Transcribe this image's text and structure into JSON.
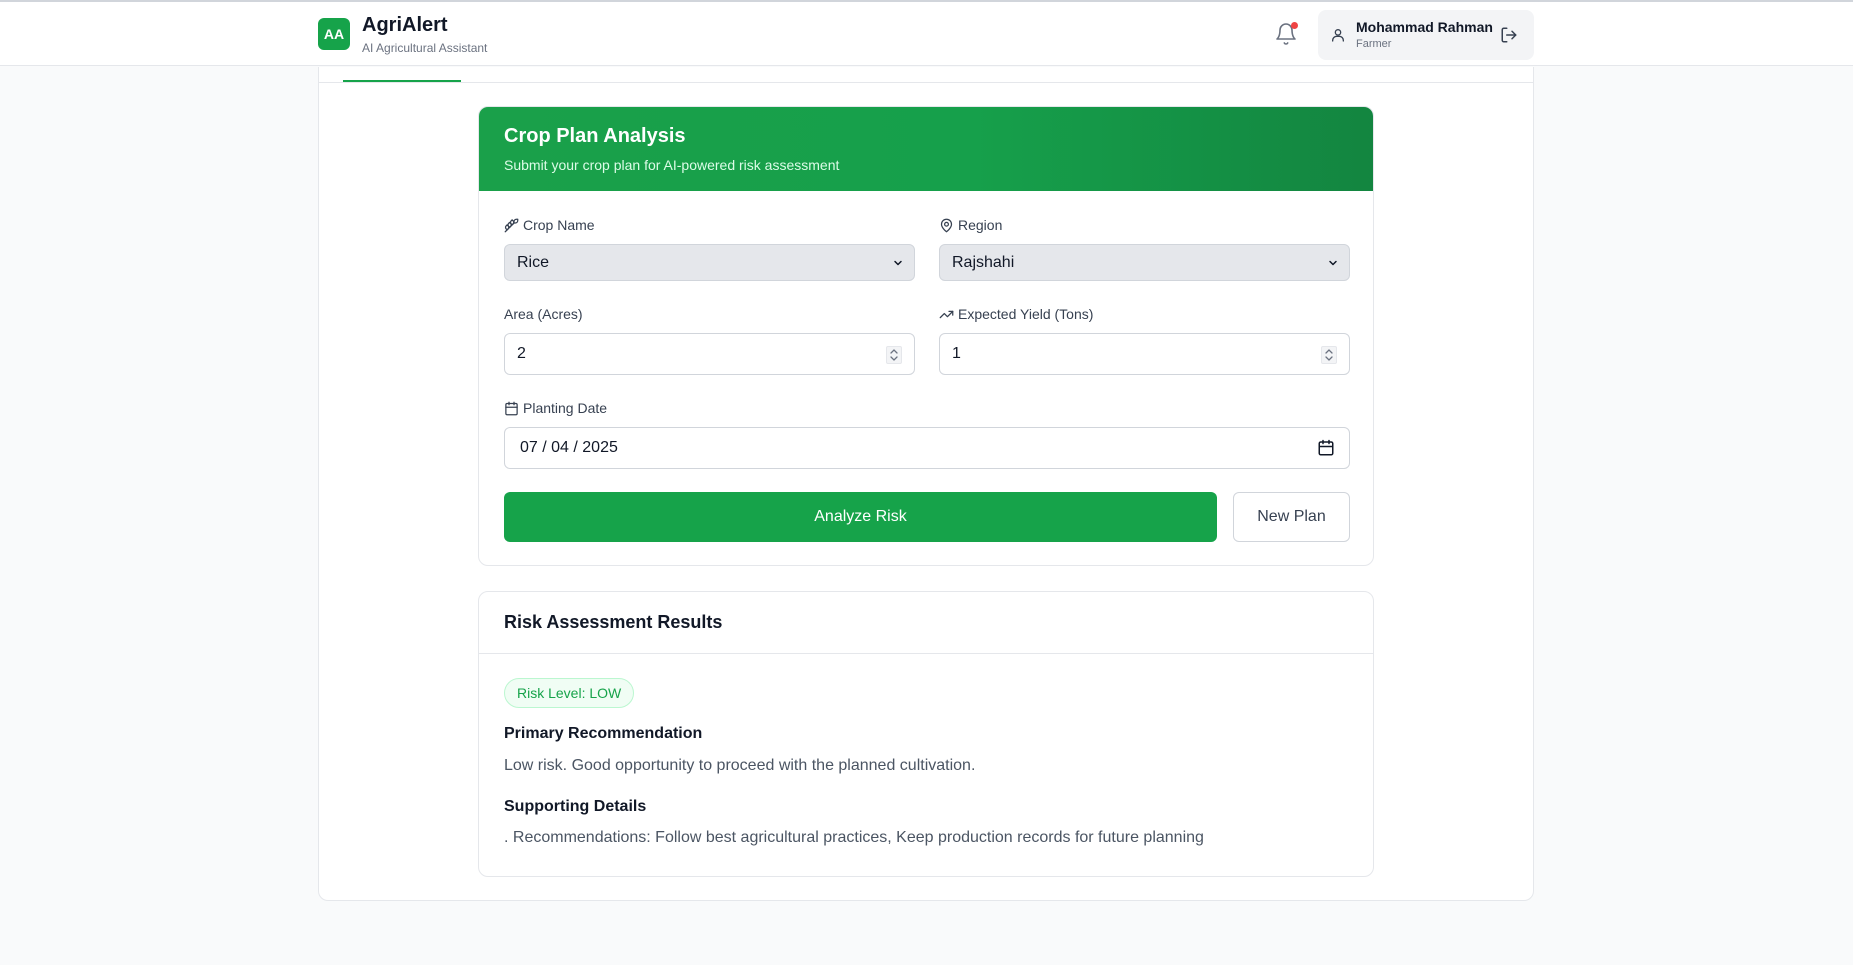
{
  "app": {
    "logo_text": "AA",
    "title": "AgriAlert",
    "subtitle": "AI Agricultural Assistant"
  },
  "user": {
    "name": "Mohammad Rahman",
    "role": "Farmer"
  },
  "form": {
    "title": "Crop Plan Analysis",
    "subtitle": "Submit your crop plan for AI-powered risk assessment",
    "crop_label": "Crop Name",
    "crop_value": "Rice",
    "region_label": "Region",
    "region_value": "Rajshahi",
    "area_label": "Area (Acres)",
    "area_value": "2",
    "yield_label": "Expected Yield (Tons)",
    "yield_value": "1",
    "date_label": "Planting Date",
    "date_value": "07 / 04 / 2025",
    "analyze_button": "Analyze Risk",
    "new_plan_button": "New Plan"
  },
  "results": {
    "title": "Risk Assessment Results",
    "risk_badge": "Risk Level: LOW",
    "primary_title": "Primary Recommendation",
    "primary_text": "Low risk. Good opportunity to proceed with the planned cultivation.",
    "details_title": "Supporting Details",
    "details_text": ". Recommendations: Follow best agricultural practices, Keep production records for future planning"
  },
  "colors": {
    "accent": "#16a34a",
    "notification_dot": "#ef4444"
  }
}
